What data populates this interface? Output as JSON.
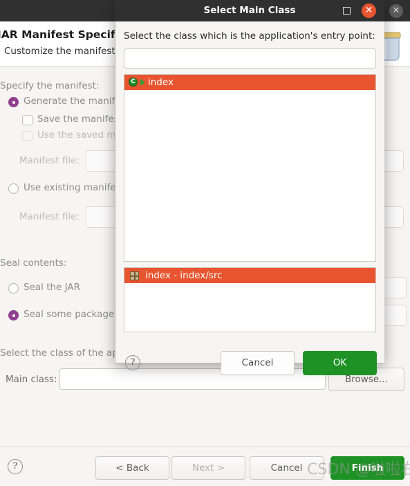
{
  "background_window": {
    "titlebar": {
      "close_icon": "close-icon"
    },
    "header": {
      "title": "JAR Manifest Specification",
      "subtitle": "Customize the manifest file for the JAR file.",
      "icon": "jar-file-icon"
    },
    "sections": {
      "specify_manifest_label": "Specify the manifest:",
      "generate_manifest_radio": "Generate the manifest file",
      "save_manifest_checkbox": "Save the manifest in the workspace",
      "use_saved_manifest_checkbox": "Use the saved manifest",
      "manifest_file_label_1": "Manifest file:",
      "use_existing_manifest_radio": "Use existing manifest from workspace",
      "manifest_file_label_2": "Manifest file:",
      "seal_contents_label": "Seal contents:",
      "seal_jar_radio": "Seal the JAR",
      "seal_packages_radio": "Seal some packages",
      "select_class_label": "Select the class of the application entry point:",
      "main_class_label": "Main class:",
      "browse_button": "Browse..."
    },
    "footer": {
      "help_icon": "help-icon",
      "back_button": "< Back",
      "next_button": "Next >",
      "cancel_button": "Cancel",
      "finish_button": "Finish"
    }
  },
  "dialog": {
    "title": "Select Main Class",
    "maximize_icon": "maximize-icon",
    "close_icon": "close-icon",
    "prompt": "Select the class which is the application's entry point:",
    "search_value": "",
    "search_placeholder": "",
    "matching_items": [
      {
        "icon": "java-class-icon",
        "label": "index"
      }
    ],
    "qualifier_items": [
      {
        "icon": "package-folder-icon",
        "label": "index - index/src"
      }
    ],
    "help_icon": "help-icon",
    "cancel_button": "Cancel",
    "ok_button": "OK"
  },
  "watermark": {
    "text": "CSDN @啦啦右行客"
  },
  "colors": {
    "selection_orange": "#e8542f",
    "accent_green": "#1f9226",
    "radio_purple": "#903f8f",
    "titlebar_dark": "#303030"
  }
}
